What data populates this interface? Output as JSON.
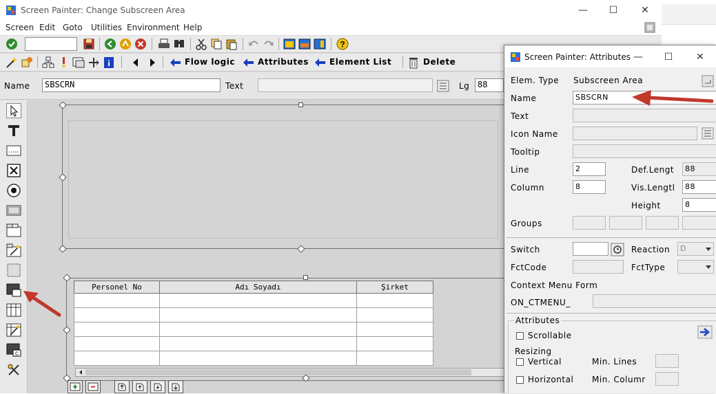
{
  "window": {
    "title": "Screen Painter: Change Subscreen Area",
    "menu": [
      "Screen",
      "Edit",
      "Goto",
      "Utilities",
      "Environment",
      "Help"
    ],
    "minimize": "—",
    "maximize": "☐",
    "close": "✕"
  },
  "app_toolbar": {
    "flow_logic": "Flow logic",
    "attributes": "Attributes",
    "element_list": "Element List",
    "delete": "Delete"
  },
  "name_bar": {
    "name_label": "Name",
    "name_value": "SBSCRN",
    "text_label": "Text",
    "text_value": "",
    "lg_label": "Lg",
    "lg_value": "88"
  },
  "table_control": {
    "columns": [
      "Personel No",
      "Adı Soyadı",
      "Şirket"
    ],
    "rows": [
      [
        "",
        "",
        ""
      ],
      [
        "",
        "",
        ""
      ],
      [
        "",
        "",
        ""
      ],
      [
        "",
        "",
        ""
      ],
      [
        "",
        "",
        ""
      ]
    ]
  },
  "dialog": {
    "title": "Screen Painter: Attributes",
    "elem_type_label": "Elem. Type",
    "elem_type_value": "Subscreen Area",
    "name_label": "Name",
    "name_value": "SBSCRN",
    "text_label": "Text",
    "icon_name_label": "Icon Name",
    "tooltip_label": "Tooltip",
    "line_label": "Line",
    "line_value": "2",
    "column_label": "Column",
    "column_value": "8",
    "def_length_label": "Def.Lengt",
    "def_length_value": "88",
    "vis_length_label": "Vis.Lengtl",
    "vis_length_value": "88",
    "height_label": "Height",
    "height_value": "8",
    "groups_label": "Groups",
    "switch_label": "Switch",
    "reaction_label": "Reaction",
    "reaction_value": "D",
    "fctcode_label": "FctCode",
    "fcttype_label": "FctType",
    "context_menu_label": "Context Menu Form",
    "context_menu_prefix": "ON_CTMENU_",
    "attributes_group": "Attributes",
    "scrollable_label": "Scrollable",
    "resizing_label": "Resizing",
    "vertical_label": "Vertical",
    "min_lines_label": "Min. Lines",
    "horizontal_label": "Horizontal",
    "min_columns_label": "Min. Columr"
  },
  "colors": {
    "annotation_arrow": "#c0392b",
    "sap_blue": "#1a3fbf"
  }
}
